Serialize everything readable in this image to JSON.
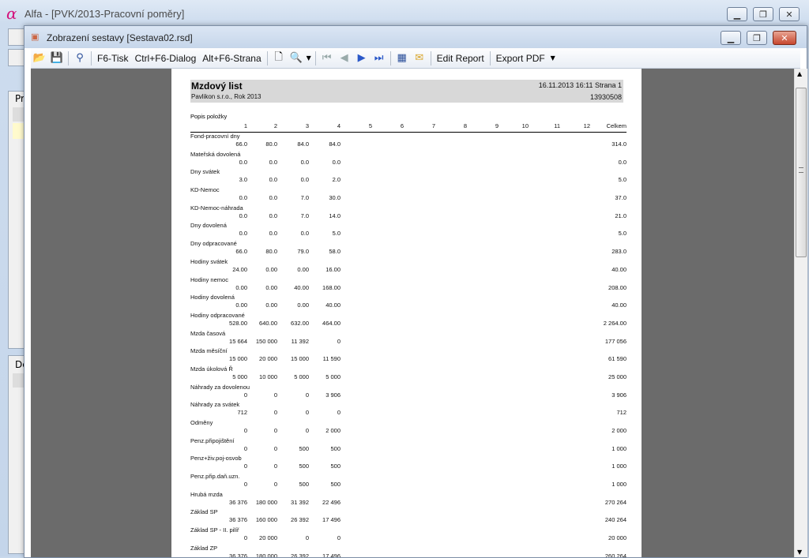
{
  "outer_window": {
    "title": "Alfa - [PVK/2013-Pracovní poměry]",
    "logo": "α"
  },
  "inner_window": {
    "title": "Zobrazení sestavy [Sestava02.rsd]"
  },
  "toolbar": {
    "f6": "F6-Tisk",
    "ctrlf6": "Ctrl+F6-Dialog",
    "altf6": "Alt+F6-Strana",
    "edit_report": "Edit Report",
    "export_pdf": "Export PDF"
  },
  "background_fragments": {
    "pr": "Pr",
    "de": "De"
  },
  "report": {
    "title": "Mzdový list",
    "subtitle": "Pavlikon s.r.o., Rok 2013",
    "date": "16.11.2013 16:11   Strana 1",
    "number": "13930508",
    "col_label": "Popis položky",
    "columns": [
      "1",
      "2",
      "3",
      "4",
      "5",
      "6",
      "7",
      "8",
      "9",
      "10",
      "11",
      "12",
      "Celkem"
    ],
    "rows": [
      {
        "label": "Fond-pracovní dny",
        "vals": [
          "66.0",
          "80.0",
          "84.0",
          "84.0"
        ],
        "total": "314.0"
      },
      {
        "label": "Mateřská dovolená",
        "vals": [
          "0.0",
          "0.0",
          "0.0",
          "0.0"
        ],
        "total": "0.0"
      },
      {
        "label": "Dny svátek",
        "vals": [
          "3.0",
          "0.0",
          "0.0",
          "2.0"
        ],
        "total": "5.0"
      },
      {
        "label": "KD-Nemoc",
        "vals": [
          "0.0",
          "0.0",
          "7.0",
          "30.0"
        ],
        "total": "37.0"
      },
      {
        "label": "KD-Nemoc-náhrada",
        "vals": [
          "0.0",
          "0.0",
          "7.0",
          "14.0"
        ],
        "total": "21.0"
      },
      {
        "label": "Dny dovolená",
        "vals": [
          "0.0",
          "0.0",
          "0.0",
          "5.0"
        ],
        "total": "5.0"
      },
      {
        "label": "Dny odpracované",
        "vals": [
          "66.0",
          "80.0",
          "79.0",
          "58.0"
        ],
        "total": "283.0"
      },
      {
        "label": "Hodiny svátek",
        "vals": [
          "24.00",
          "0.00",
          "0.00",
          "16.00"
        ],
        "total": "40.00"
      },
      {
        "label": "Hodiny nemoc",
        "vals": [
          "0.00",
          "0.00",
          "40.00",
          "168.00"
        ],
        "total": "208.00"
      },
      {
        "label": "Hodiny dovolená",
        "vals": [
          "0.00",
          "0.00",
          "0.00",
          "40.00"
        ],
        "total": "40.00"
      },
      {
        "label": "Hodiny odpracované",
        "vals": [
          "528.00",
          "640.00",
          "632.00",
          "464.00"
        ],
        "total": "2 264.00"
      },
      {
        "label": "Mzda časová",
        "vals": [
          "15 664",
          "150 000",
          "11 392",
          "0"
        ],
        "total": "177 056"
      },
      {
        "label": "Mzda měsíční",
        "vals": [
          "15 000",
          "20 000",
          "15 000",
          "11 590"
        ],
        "total": "61 590"
      },
      {
        "label": "Mzda úkolová Ř",
        "vals": [
          "5 000",
          "10 000",
          "5 000",
          "5 000"
        ],
        "total": "25 000"
      },
      {
        "label": "Náhrady za dovolenou",
        "vals": [
          "0",
          "0",
          "0",
          "3 906"
        ],
        "total": "3 906"
      },
      {
        "label": "Náhrady za svátek",
        "vals": [
          "712",
          "0",
          "0",
          "0"
        ],
        "total": "712"
      },
      {
        "label": "Odměny",
        "vals": [
          "0",
          "0",
          "0",
          "2 000"
        ],
        "total": "2 000"
      },
      {
        "label": "Penz.připojištění",
        "vals": [
          "0",
          "0",
          "500",
          "500"
        ],
        "total": "1 000"
      },
      {
        "label": "Penz+živ.poj-osvob",
        "vals": [
          "0",
          "0",
          "500",
          "500"
        ],
        "total": "1 000"
      },
      {
        "label": "Penz.přip.daň.uzn.",
        "vals": [
          "0",
          "0",
          "500",
          "500"
        ],
        "total": "1 000"
      },
      {
        "label": "Hrubá mzda",
        "vals": [
          "36 376",
          "180 000",
          "31 392",
          "22 496"
        ],
        "total": "270 264"
      },
      {
        "label": "Základ SP",
        "vals": [
          "36 376",
          "160 000",
          "26 392",
          "17 496"
        ],
        "total": "240 264"
      },
      {
        "label": "Základ SP - II. pilíř",
        "vals": [
          "0",
          "20 000",
          "0",
          "0"
        ],
        "total": "20 000"
      },
      {
        "label": "Základ ZP",
        "vals": [
          "36 376",
          "180 000",
          "26 392",
          "17 496"
        ],
        "total": "260 264"
      }
    ]
  }
}
